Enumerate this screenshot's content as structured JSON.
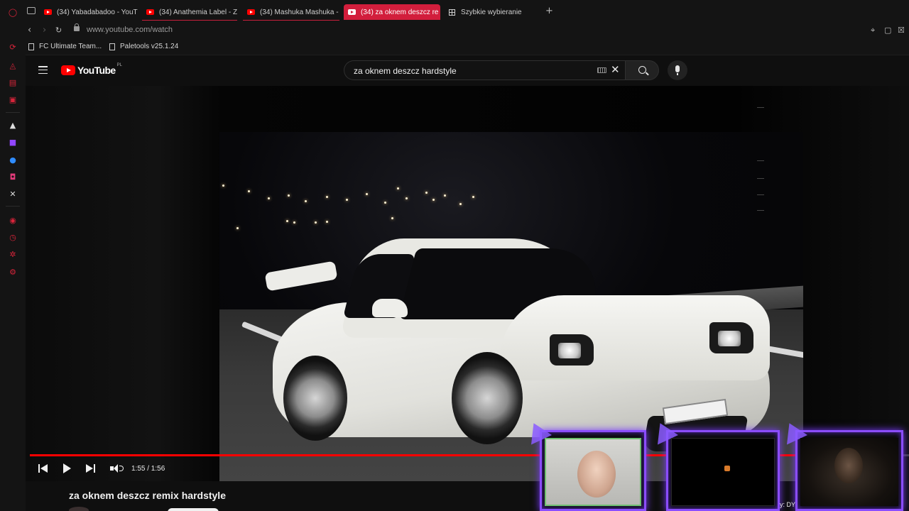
{
  "browser": {
    "tabs": [
      {
        "label": "(34) Yabadabadoo - YouT",
        "active": false
      },
      {
        "label": "(34) Anathemia Label - Z",
        "active": false
      },
      {
        "label": "(34) Mashuka Mashuka -",
        "active": false
      },
      {
        "label": "(34) za oknem deszcz re",
        "active": true
      },
      {
        "label": "Szybkie wybieranie",
        "active": false
      }
    ],
    "new_tab_symbol": "+",
    "url": "www.youtube.com/watch",
    "bookmarks": [
      "FC Ultimate Team...",
      "Paletools v25.1.24"
    ],
    "accent_color": "#d21e3c"
  },
  "youtube": {
    "logo_text": "YouTube",
    "region": "PL",
    "search_query": "za oknem deszcz hardstyle",
    "clear_symbol": "✕"
  },
  "player": {
    "current_time": "1:55",
    "duration": "1:56",
    "time_display": "1:55 / 1:56",
    "progress_fraction": 0.99,
    "progress_color": "#ff0000"
  },
  "video": {
    "title": "za oknem deszcz remix hardstyle"
  },
  "overlay": {
    "caption": "y: DY",
    "frame_color": "#8b4dff"
  }
}
